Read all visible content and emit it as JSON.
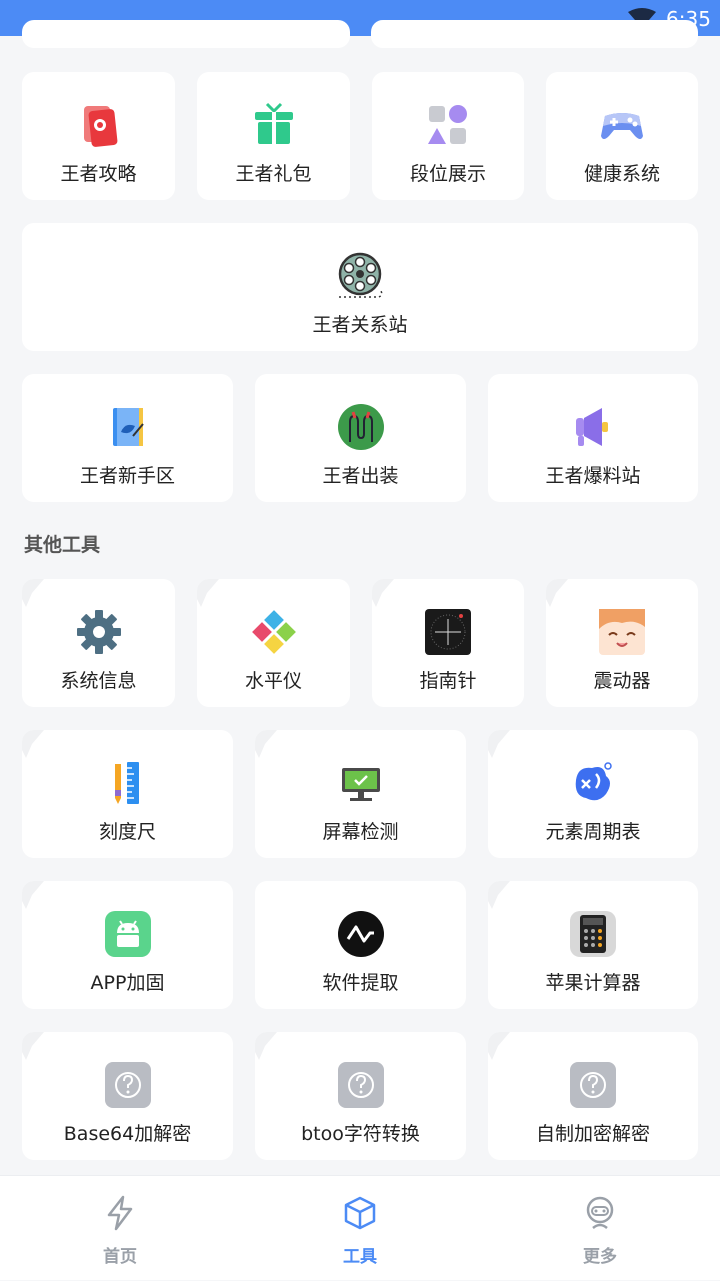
{
  "status": {
    "time": "6:35"
  },
  "game_tools": [
    {
      "label": "王者攻略",
      "icon": "red-cards-icon"
    },
    {
      "label": "王者礼包",
      "icon": "gift-icon"
    },
    {
      "label": "段位展示",
      "icon": "shapes-icon"
    },
    {
      "label": "健康系统",
      "icon": "gamepad-icon"
    },
    {
      "label": "王者关系站",
      "icon": "film-reel-icon"
    },
    {
      "label": "王者新手区",
      "icon": "notebook-icon"
    },
    {
      "label": "王者出装",
      "icon": "green-circle-icon"
    },
    {
      "label": "王者爆料站",
      "icon": "megaphone-icon"
    }
  ],
  "other_section": {
    "title": "其他工具"
  },
  "other_tools": [
    {
      "label": "系统信息",
      "icon": "gear-icon"
    },
    {
      "label": "水平仪",
      "icon": "puzzle-icon"
    },
    {
      "label": "指南针",
      "icon": "compass-icon"
    },
    {
      "label": "震动器",
      "icon": "anime-face-icon"
    },
    {
      "label": "刻度尺",
      "icon": "ruler-pencil-icon"
    },
    {
      "label": "屏幕检测",
      "icon": "monitor-check-icon"
    },
    {
      "label": "元素周期表",
      "icon": "element-icon"
    },
    {
      "label": "APP加固",
      "icon": "android-icon"
    },
    {
      "label": "软件提取",
      "icon": "pulse-icon"
    },
    {
      "label": "苹果计算器",
      "icon": "calculator-icon"
    },
    {
      "label": "Base64加解密",
      "icon": "question-icon"
    },
    {
      "label": "btoo字符转换",
      "icon": "question-icon"
    },
    {
      "label": "自制加密解密",
      "icon": "question-icon"
    }
  ],
  "tabs": [
    {
      "label": "首页",
      "icon": "lightning-icon",
      "active": false
    },
    {
      "label": "工具",
      "icon": "cube-icon",
      "active": true
    },
    {
      "label": "更多",
      "icon": "robot-icon",
      "active": false
    }
  ],
  "colors": {
    "accent": "#4c8bf5",
    "background": "#f5f6f8",
    "inactive": "#9aa0a8"
  }
}
